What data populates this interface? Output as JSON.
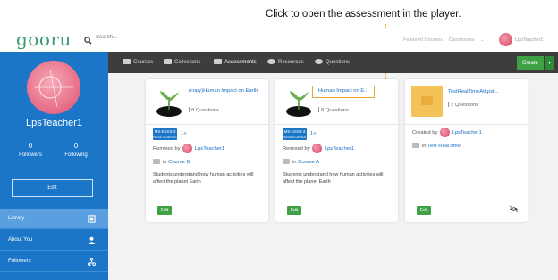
{
  "callout": {
    "text": "Click to open the assessment in the player."
  },
  "header": {
    "logo": "gooru",
    "search_placeholder": "Search...",
    "featured_courses": "Featured Courses",
    "classrooms": "Classrooms",
    "username": "LpsTeacher1"
  },
  "profile": {
    "name": "LpsTeacher1",
    "followers_count": "0",
    "followers_label": "Followers",
    "following_count": "0",
    "following_label": "Following",
    "edit_label": "Edit"
  },
  "sidebar": {
    "items": [
      {
        "label": "Library",
        "icon": "library-icon",
        "active": true
      },
      {
        "label": "About You",
        "icon": "user-icon",
        "active": false
      },
      {
        "label": "Followers",
        "icon": "network-icon",
        "active": false
      }
    ]
  },
  "tabs": [
    {
      "label": "Courses",
      "icon": "courses-icon"
    },
    {
      "label": "Collections",
      "icon": "collections-icon"
    },
    {
      "label": "Assessments",
      "icon": "assessments-icon",
      "active": true
    },
    {
      "label": "Resources",
      "icon": "resources-icon"
    },
    {
      "label": "Questions",
      "icon": "questions-icon"
    }
  ],
  "create_label": "Create",
  "cards": [
    {
      "title": "(copy)Human Impact on Earth",
      "question_count": "8 Questions",
      "standard_code": "MS-ESS3-3",
      "standard_sub": "NGSS SCIENCE",
      "standard_more": "1+",
      "remixed_by_label": "Remixed by",
      "author": "LpsTeacher1",
      "in_label": "in",
      "course": "Course B",
      "description": "Students understand how human activities will affect the planet Earth",
      "edit_label": "Edit"
    },
    {
      "title": "Human Impact on E...",
      "question_count": "8 Questions",
      "standard_code": "MS-ESS3-3",
      "standard_sub": "NGSS SCIENCE",
      "standard_more": "1+",
      "remixed_by_label": "Remixed by",
      "author": "LpsTeacher1",
      "in_label": "in",
      "course": "Course A",
      "description": "Students understand how human activities will affect the planet Earth",
      "edit_label": "Edit"
    },
    {
      "title": "TestRealTimeAtLpst...",
      "question_count": "2 Questions",
      "created_by_label": "Created by",
      "author": "LpsTeacher1",
      "in_label": "in",
      "course": "Test RealTime",
      "edit_label": "Edit",
      "visibility_icon": "eye-off-icon"
    }
  ],
  "colors": {
    "sidebar": "#1b76c8",
    "tabbar": "#3d3d3d",
    "accent_green": "#3fa046",
    "link_blue": "#1a6fc4",
    "highlight_orange": "#f0a23a"
  }
}
